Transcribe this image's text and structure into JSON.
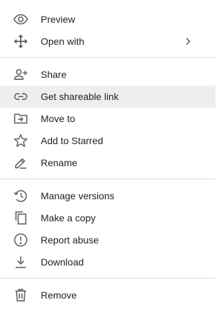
{
  "colors": {
    "icon": "#5f6368",
    "text": "#202124",
    "highlight": "#eeeeee",
    "divider": "#dadce0"
  },
  "menu": {
    "groups": [
      {
        "items": [
          {
            "label": "Preview",
            "icon": "eye-icon"
          },
          {
            "label": "Open with",
            "icon": "move-arrows-icon",
            "submenu": "chevron-right-icon"
          }
        ]
      },
      {
        "items": [
          {
            "label": "Share",
            "icon": "person-add-icon"
          },
          {
            "label": "Get shareable link",
            "icon": "link-icon",
            "highlighted": true
          },
          {
            "label": "Move to",
            "icon": "folder-move-icon"
          },
          {
            "label": "Add to Starred",
            "icon": "star-outline-icon"
          },
          {
            "label": "Rename",
            "icon": "pencil-icon"
          }
        ]
      },
      {
        "items": [
          {
            "label": "Manage versions",
            "icon": "history-icon"
          },
          {
            "label": "Make a copy",
            "icon": "copy-icon"
          },
          {
            "label": "Report abuse",
            "icon": "alert-circle-icon"
          },
          {
            "label": "Download",
            "icon": "download-icon"
          }
        ]
      },
      {
        "items": [
          {
            "label": "Remove",
            "icon": "trash-icon"
          }
        ]
      }
    ]
  }
}
